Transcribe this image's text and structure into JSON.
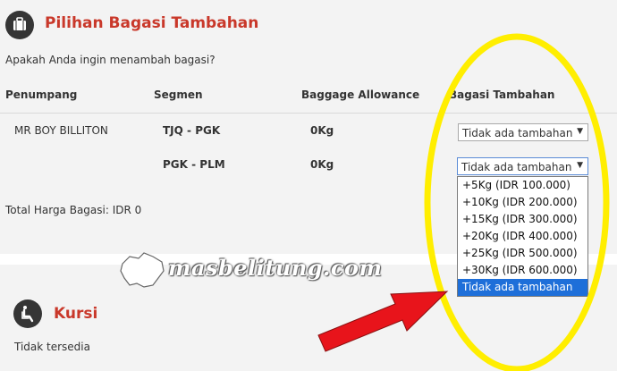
{
  "baggage_section": {
    "title": "Pilihan Bagasi Tambahan",
    "question": "Apakah Anda ingin menambah bagasi?",
    "headers": {
      "passenger": "Penumpang",
      "segment": "Segmen",
      "allowance": "Baggage Allowance",
      "extra": "Bagasi Tambahan"
    },
    "passenger_name": "MR BOY BILLITON",
    "rows": [
      {
        "segment": "TJQ - PGK",
        "allowance": "0Kg",
        "selected": "Tidak ada tambahan"
      },
      {
        "segment": "PGK - PLM",
        "allowance": "0Kg",
        "selected": "Tidak ada tambahan"
      }
    ],
    "dropdown_options": [
      "+5Kg (IDR 100.000)",
      "+10Kg (IDR 200.000)",
      "+15Kg (IDR 300.000)",
      "+20Kg (IDR 400.000)",
      "+25Kg (IDR 500.000)",
      "+30Kg (IDR 600.000)",
      "Tidak ada tambahan"
    ],
    "total_label": "Total Harga Bagasi: IDR 0"
  },
  "seat_section": {
    "title": "Kursi",
    "status": "Tidak tersedia"
  },
  "watermark": "masbelitung.com",
  "annotation_colors": {
    "ellipse": "#ffee00",
    "arrow": "#e8141b"
  },
  "icons": [
    "briefcase-icon",
    "seat-icon",
    "dropdown-arrow-icon"
  ]
}
